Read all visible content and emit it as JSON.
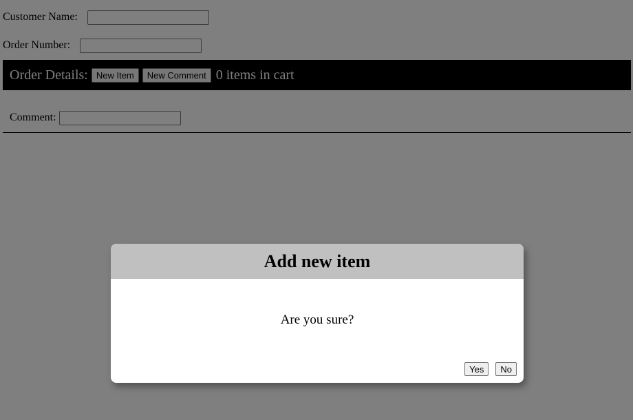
{
  "form": {
    "customer_name_label": "Customer Name:",
    "customer_name_value": "",
    "order_number_label": "Order Number:",
    "order_number_value": "",
    "comment_label": "Comment:",
    "comment_value": ""
  },
  "order_bar": {
    "title": "Order Details:",
    "new_item_label": "New Item",
    "new_comment_label": "New Comment",
    "cart_status": "0 items in cart"
  },
  "dialog": {
    "title": "Add new item",
    "message": "Are you sure?",
    "yes_label": "Yes",
    "no_label": "No"
  },
  "colors": {
    "order_bar_bg": "#000000",
    "dialog_header_bg": "#c0c0c0",
    "overlay": "rgba(0,0,0,0.5)"
  }
}
